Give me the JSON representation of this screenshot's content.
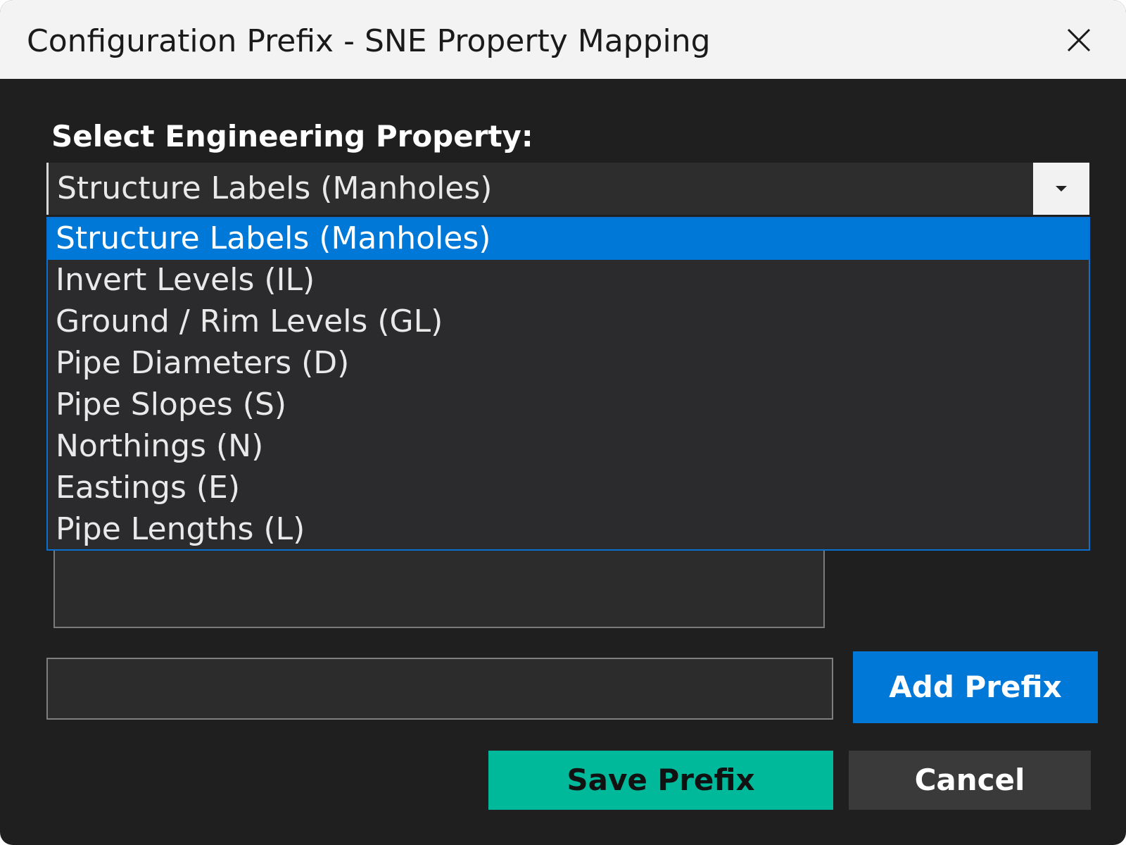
{
  "window": {
    "title": "Configuration Prefix - SNE Property Mapping",
    "close_icon": "close-icon"
  },
  "property_select": {
    "label": "Select Engineering Property:",
    "selected_value": "Structure Labels (Manholes)",
    "arrow_icon": "chevron-down-icon",
    "options": [
      "Structure Labels (Manholes)",
      "Invert Levels (IL)",
      "Ground / Rim Levels (GL)",
      "Pipe Diameters (D)",
      "Pipe Slopes (S)",
      "Northings (N)",
      "Eastings (E)",
      "Pipe Lengths (L)"
    ],
    "highlighted_index": 0
  },
  "prefix_input": {
    "value": "",
    "placeholder": ""
  },
  "buttons": {
    "add_prefix": "Add Prefix",
    "save_prefix": "Save Prefix",
    "cancel": "Cancel"
  },
  "colors": {
    "accent_blue": "#0078d7",
    "save_green": "#00b89a",
    "background": "#1f1f1f"
  }
}
